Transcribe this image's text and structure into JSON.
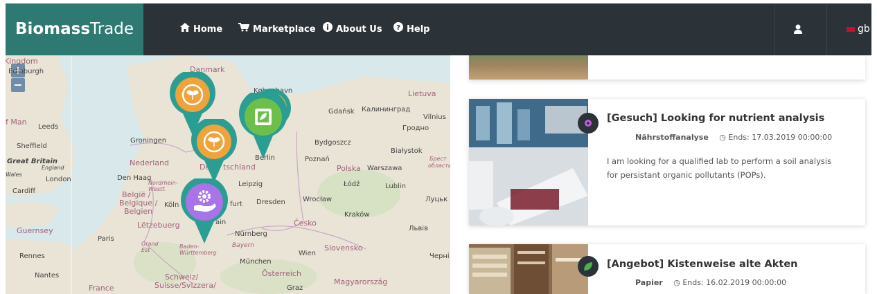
{
  "brand": {
    "bold": "Biomass",
    "light": "Trade"
  },
  "nav": {
    "home": "Home",
    "marketplace": "Marketplace",
    "about": "About Us",
    "help": "Help",
    "language": "gb"
  },
  "map": {
    "zoom_in": "+",
    "zoom_out": "−",
    "labels": {
      "kingdom": "Kingdom",
      "edinburgh": "Edinburgh",
      "isle_of_man": "f Man",
      "leeds": "Leeds",
      "sheffield": "Sheffield",
      "great_britain": "Great Britain",
      "england": "England",
      "wales": "Wales",
      "london": "London",
      "cardiff": "Cardiff",
      "guernsey": "Guernsey",
      "rennes": "Rennes",
      "nantes": "Nantes",
      "france": "France",
      "paris": "Paris",
      "grand_est": "Grand\nEst",
      "danmark": "Danmark",
      "kobenhavn": "København",
      "lietuva": "Lietuva",
      "gdansk": "Gdańsk",
      "kaliningrad": "Калининград",
      "vilnius": "Vilnius",
      "grodno": "Гродно",
      "groningen": "Groningen",
      "nederland": "Nederland",
      "den_haag": "Den Haag",
      "belgie": "België /",
      "belgique": "Belgique /",
      "belgien": "Belgien",
      "koln": "Köln",
      "nordrhein": "Nordrhein-\nWestf.",
      "deutschland_a": "De",
      "deutschland_b": "tschland",
      "berlin": "Berlin",
      "bydgoszcz": "Bydgoszcz",
      "bialystok": "Białystok",
      "brest": "Брест",
      "oblast": "область",
      "poznan": "Poznań",
      "polska": "Polska",
      "warszawa": "Warszawa",
      "leipzig": "Leipzig",
      "lodz": "Łódź",
      "lublin": "Lublin",
      "dresden": "Dresden",
      "wroclaw": "Wrocław",
      "lutsk": "Луцьк",
      "frankfurt": "furt",
      "krakow": "Kraków",
      "letzebuerg": "Lëtzebuerg",
      "cesko": "Česko",
      "lviv": "Львів",
      "nurnberg": "Nürnberg",
      "ain": "ain",
      "baden": "Baden-\nWürttemberg",
      "bayern": "Bayern",
      "munchen": "München",
      "wien": "Wien",
      "slovensko": "Slovensko",
      "cherni": "Черні",
      "osterreich": "Österreich",
      "schweiz": "Schweiz/",
      "suisse": "Suisse/Svizzera/",
      "graz": "Graz",
      "magyarorszag": "Magyarország"
    }
  },
  "listings": [
    {
      "title": "",
      "category": "",
      "ends": "",
      "description": ""
    },
    {
      "title": "[Gesuch] Looking for nutrient analysis",
      "category": "Nährstoffanalyse",
      "ends": "Ends: 17.03.2019 00:00:00",
      "description": "I am looking for a qualified lab to perform a soil analysis for persistant organic pollutants (POPs)."
    },
    {
      "title": "[Angebot] Kistenweise alte Akten",
      "category": "Papier",
      "ends": "Ends: 16.02.2019 00:00:00",
      "description": ""
    }
  ],
  "colors": {
    "brand": "#2e7a72",
    "navbar": "#2c3338",
    "marker_teal": "#2b9e94",
    "marker_orange": "#f0a23b",
    "marker_green": "#6cc04a",
    "marker_purple": "#a874e8"
  }
}
